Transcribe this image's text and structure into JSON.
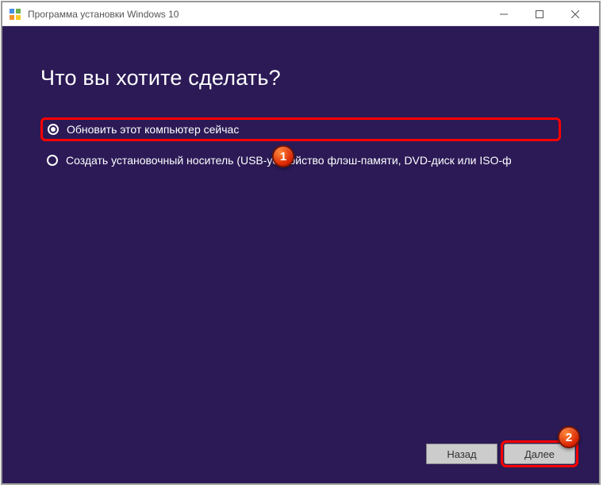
{
  "window": {
    "title": "Программа установки Windows 10"
  },
  "main": {
    "heading": "Что вы хотите сделать?",
    "options": [
      {
        "label": "Обновить этот компьютер сейчас",
        "selected": true
      },
      {
        "label": "Создать установочный носитель (USB-устройство флэш-памяти, DVD-диск или ISO-ф",
        "selected": false
      }
    ]
  },
  "footer": {
    "back": "Назад",
    "next": "Далее"
  },
  "markers": {
    "one": "1",
    "two": "2"
  }
}
